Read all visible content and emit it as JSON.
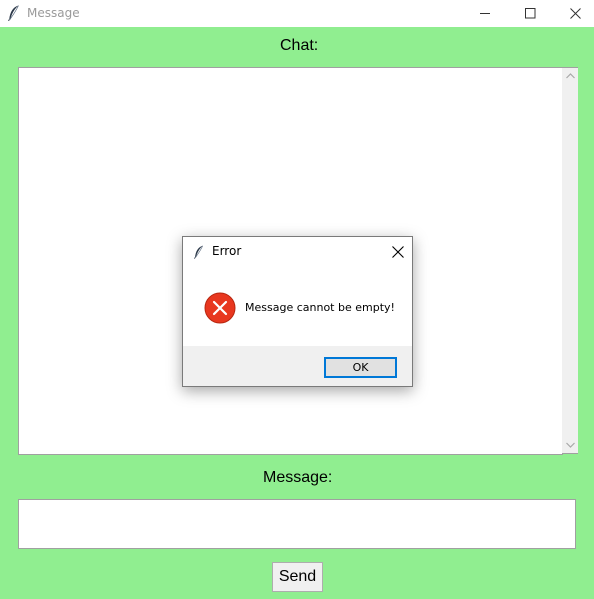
{
  "window": {
    "title": "Message",
    "icon": "feather-icon",
    "background_color": "#90ee90"
  },
  "chat": {
    "label": "Chat:",
    "content": ""
  },
  "message": {
    "label": "Message:",
    "value": "",
    "placeholder": ""
  },
  "send_button": {
    "label": "Send"
  },
  "error_dialog": {
    "title": "Error",
    "icon": "error-icon",
    "message": "Message cannot be empty!",
    "ok_label": "OK",
    "accent_color": "#0078d7",
    "error_color": "#e8371f"
  }
}
